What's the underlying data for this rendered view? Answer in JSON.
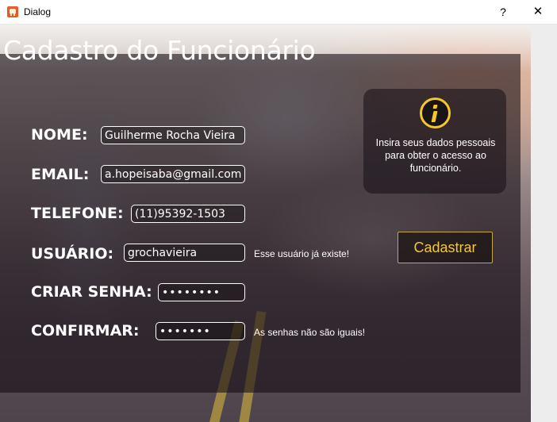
{
  "window": {
    "title": "Dialog",
    "help_label": "?",
    "close_label": "✕"
  },
  "form": {
    "title": "Cadastro do Funcionário",
    "fields": {
      "nome": {
        "label": "NOME:",
        "value": "Guilherme Rocha Vieira"
      },
      "email": {
        "label": "EMAIL:",
        "value": "a.hopeisaba@gmail.com"
      },
      "telefone": {
        "label": "TELEFONE:",
        "value": "(11)95392-1503"
      },
      "usuario": {
        "label": "USUÁRIO:",
        "value": "grochavieira"
      },
      "criar_senha": {
        "label": "CRIAR SENHA:",
        "value": "••••••••"
      },
      "confirmar": {
        "label": "CONFIRMAR:",
        "value": "•••••••"
      }
    },
    "messages": {
      "usuario_error": "Esse usuário já existe!",
      "senha_error": "As senhas não são iguais!"
    }
  },
  "info": {
    "text": "Insira seus dados pessoais para obter o acesso ao funcionário."
  },
  "actions": {
    "cadastrar_label": "Cadastrar"
  },
  "colors": {
    "accent": "#f2c83a",
    "panel": "#160e16"
  }
}
